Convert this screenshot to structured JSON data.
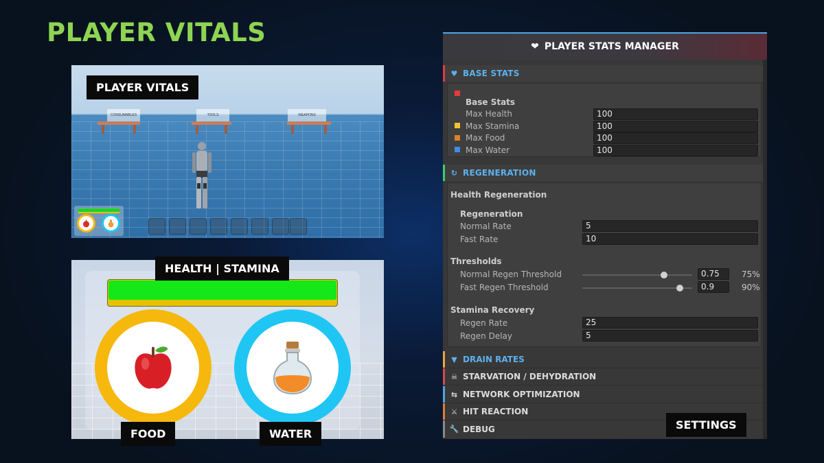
{
  "title": "PLAYER VITALS",
  "scene_panel": {
    "label": "PLAYER VITALS",
    "tables": [
      "CONSUMABLES",
      "TOOLS",
      "WEAPONS"
    ],
    "hotbar_slots": 8
  },
  "hud_panel": {
    "bar_label": "HEALTH | STAMINA",
    "health_fraction": 1.0,
    "stamina_fraction": 1.0,
    "food_label": "FOOD",
    "water_label": "WATER",
    "colors": {
      "health": "#15e818",
      "stamina": "#e6c200",
      "food_ring": "#f6b80d",
      "water_ring": "#1fc6f4"
    }
  },
  "inspector": {
    "title": "PLAYER STATS MANAGER",
    "base_stats": {
      "header": "BASE STATS",
      "group": "Base Stats",
      "rows": [
        {
          "label": "Max Health",
          "value": "100",
          "color": "#e23b3b"
        },
        {
          "label": "Max Stamina",
          "value": "100",
          "color": "#f2c230"
        },
        {
          "label": "Max Food",
          "value": "100",
          "color": "#d9822b"
        },
        {
          "label": "Max Water",
          "value": "100",
          "color": "#3c8ee6"
        }
      ]
    },
    "regeneration": {
      "header": "REGENERATION",
      "health_regen": "Health Regeneration",
      "regen_group": "Regeneration",
      "normal_rate_label": "Normal Rate",
      "normal_rate": "5",
      "fast_rate_label": "Fast Rate",
      "fast_rate": "10",
      "thresholds": "Thresholds",
      "normal_threshold_label": "Normal Regen Threshold",
      "normal_threshold": "0.75",
      "normal_threshold_pct": "75%",
      "fast_threshold_label": "Fast Regen Threshold",
      "fast_threshold": "0.9",
      "fast_threshold_pct": "90%",
      "stamina_recovery": "Stamina Recovery",
      "regen_rate_label": "Regen Rate",
      "regen_rate": "25",
      "regen_delay_label": "Regen Delay",
      "regen_delay": "5"
    },
    "sections": [
      {
        "label": "DRAIN RATES",
        "icon": "triangle-down-icon",
        "color": "#f0a43a"
      },
      {
        "label": "STARVATION / DEHYDRATION",
        "icon": "skull-icon",
        "color": "#d84a4a"
      },
      {
        "label": "NETWORK OPTIMIZATION",
        "icon": "swap-arrows-icon",
        "color": "#4aa8e8"
      },
      {
        "label": "HIT REACTION",
        "icon": "crossed-swords-icon",
        "color": "#e07a3a"
      },
      {
        "label": "DEBUG",
        "icon": "wrench-icon",
        "color": "#8a8a8a"
      }
    ]
  },
  "settings_label": "SETTINGS"
}
